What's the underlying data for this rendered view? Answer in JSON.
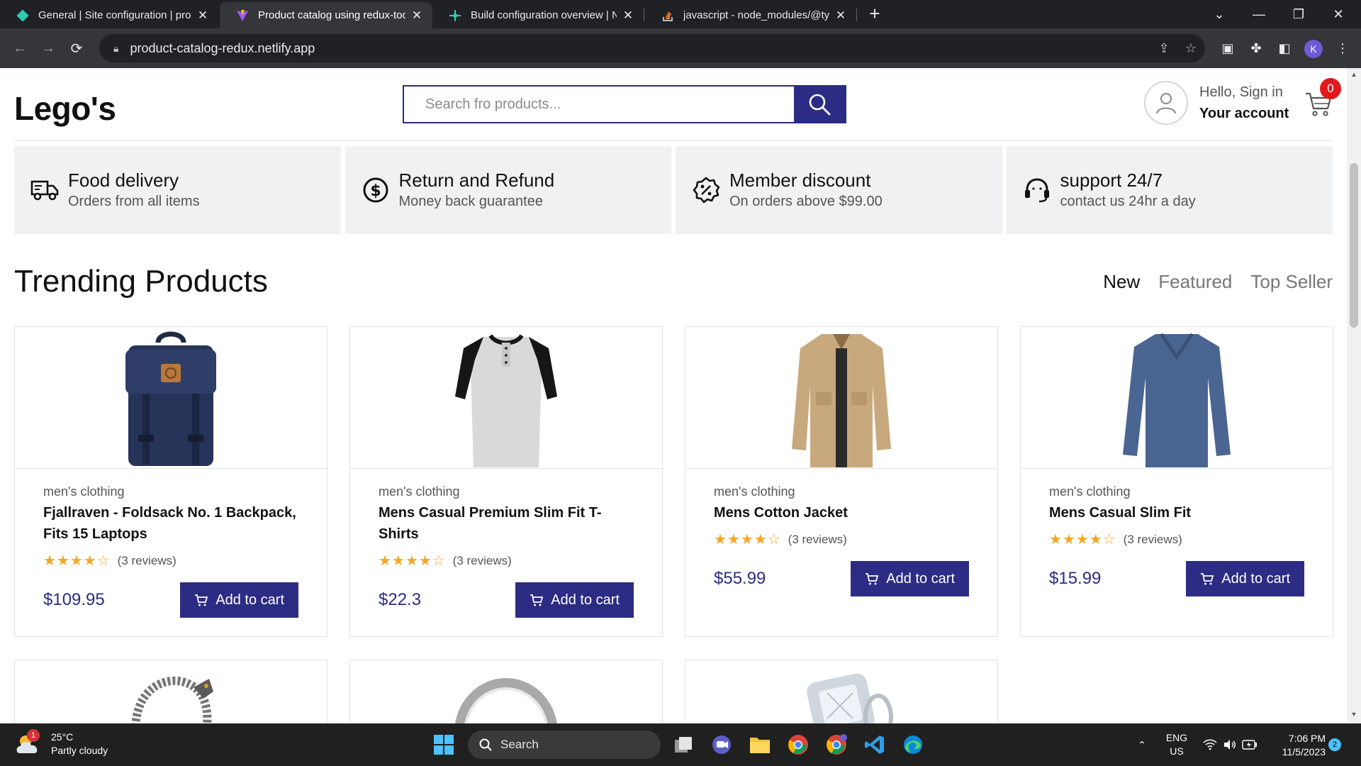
{
  "browser": {
    "tabs": [
      {
        "title": "General | Site configuration | pro",
        "icon": "netlify-icon"
      },
      {
        "title": "Product catalog using redux-too",
        "icon": "vite-icon",
        "active": true
      },
      {
        "title": "Build configuration overview | N",
        "icon": "netlify-build-icon"
      },
      {
        "title": "javascript - node_modules/@typ",
        "icon": "stackoverflow-icon"
      }
    ],
    "new_tab_label": "+",
    "url": "product-catalog-redux.netlify.app",
    "profile_initial": "K"
  },
  "header": {
    "logo": "Lego's",
    "search_placeholder": "Search fro products...",
    "greeting": "Hello, Sign in",
    "account_label": "Your account",
    "cart_count": "0"
  },
  "features": [
    {
      "title": "Food delivery",
      "subtitle": "Orders from all items",
      "icon": "truck-icon"
    },
    {
      "title": "Return and Refund",
      "subtitle": "Money back guarantee",
      "icon": "dollar-circle-icon"
    },
    {
      "title": "Member discount",
      "subtitle": "On orders above $99.00",
      "icon": "discount-badge-icon"
    },
    {
      "title": "support 24/7",
      "subtitle": "contact us 24hr a day",
      "icon": "headset-icon"
    }
  ],
  "section": {
    "title": "Trending Products",
    "filters": [
      "New",
      "Featured",
      "Top Seller"
    ],
    "active_filter": "New"
  },
  "products": [
    {
      "category": "men's clothing",
      "name": "Fjallraven - Foldsack No. 1 Backpack, Fits 15 Laptops",
      "rating": 4,
      "reviews": "(3 reviews)",
      "price": "$109.95",
      "button": "Add to cart",
      "image": "backpack"
    },
    {
      "category": "men's clothing",
      "name": "Mens Casual Premium Slim Fit T-Shirts",
      "rating": 4,
      "reviews": "(3 reviews)",
      "price": "$22.3",
      "button": "Add to cart",
      "image": "tshirt"
    },
    {
      "category": "men's clothing",
      "name": "Mens Cotton Jacket",
      "rating": 4,
      "reviews": "(3 reviews)",
      "price": "$55.99",
      "button": "Add to cart",
      "image": "jacket"
    },
    {
      "category": "men's clothing",
      "name": "Mens Casual Slim Fit",
      "rating": 4,
      "reviews": "(3 reviews)",
      "price": "$15.99",
      "button": "Add to cart",
      "image": "longsleeve"
    }
  ],
  "partial_products": [
    {
      "image": "bracelet"
    },
    {
      "image": "ring"
    },
    {
      "image": "diamond-ring"
    }
  ],
  "taskbar": {
    "temperature": "25°C",
    "weather": "Partly cloudy",
    "weather_badge": "1",
    "search_label": "Search",
    "lang": "ENG",
    "region": "US",
    "time": "7:06 PM",
    "date": "11/5/2023",
    "notifications": "2"
  },
  "colors": {
    "accent": "#2c2c84",
    "star": "#f5a623",
    "badge": "#e1191c"
  }
}
